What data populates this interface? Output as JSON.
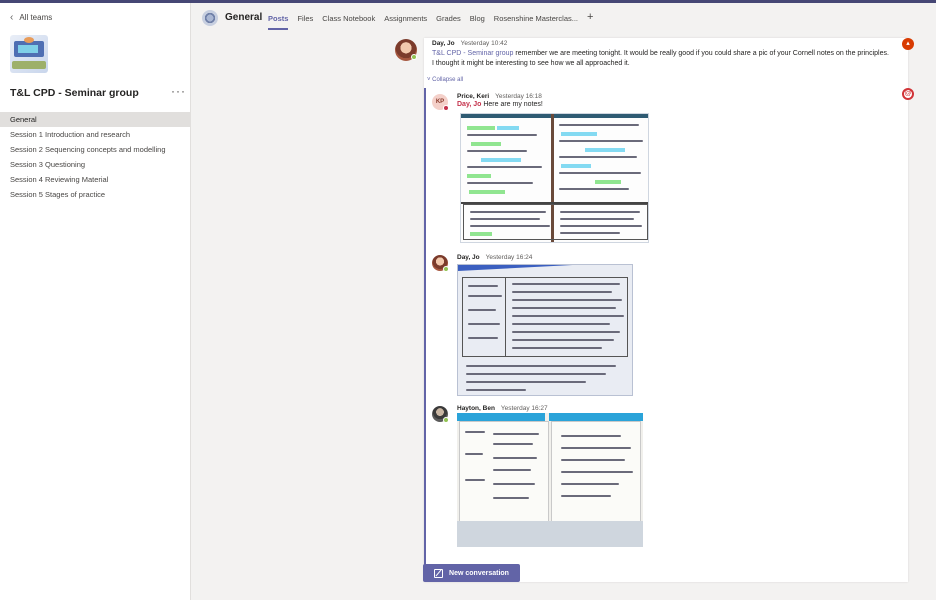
{
  "sidebar": {
    "back_label": "All teams",
    "team_name": "T&L CPD - Seminar group",
    "more": "···",
    "channels": [
      {
        "label": "General"
      },
      {
        "label": "Session 1 Introduction and research"
      },
      {
        "label": "Session 2 Sequencing concepts and modelling"
      },
      {
        "label": "Session 3 Questioning"
      },
      {
        "label": "Session 4 Reviewing Material"
      },
      {
        "label": "Session 5 Stages of practice"
      }
    ]
  },
  "header": {
    "title": "General",
    "tabs": [
      {
        "label": "Posts"
      },
      {
        "label": "Files"
      },
      {
        "label": "Class Notebook"
      },
      {
        "label": "Assignments"
      },
      {
        "label": "Grades"
      },
      {
        "label": "Blog"
      },
      {
        "label": "Rosenshine Masterclas..."
      }
    ],
    "add_tab": "+"
  },
  "thread": {
    "root": {
      "author": "Day, Jo",
      "time": "Yesterday 10:42",
      "mention": "T&L CPD - Seminar group",
      "text": " remember we are meeting tonight. It would be really good if you could share a pic of your Cornell notes on the principles. I thought it might be interesting to see how we all approached it."
    },
    "collapse_label": "Collapse all",
    "replies": [
      {
        "author": "Price, Keri",
        "initials": "KP",
        "time": "Yesterday 16:18",
        "mention": "Day, Jo",
        "text": " Here are my notes!"
      },
      {
        "author": "Day, Jo",
        "time": "Yesterday 16:24"
      },
      {
        "author": "Hayton, Ben",
        "time": "Yesterday 16:27"
      }
    ]
  },
  "new_conversation_label": "New conversation",
  "colors": {
    "accent": "#6264a7",
    "mention_red": "#c4314b",
    "presence_green": "#92c353"
  }
}
